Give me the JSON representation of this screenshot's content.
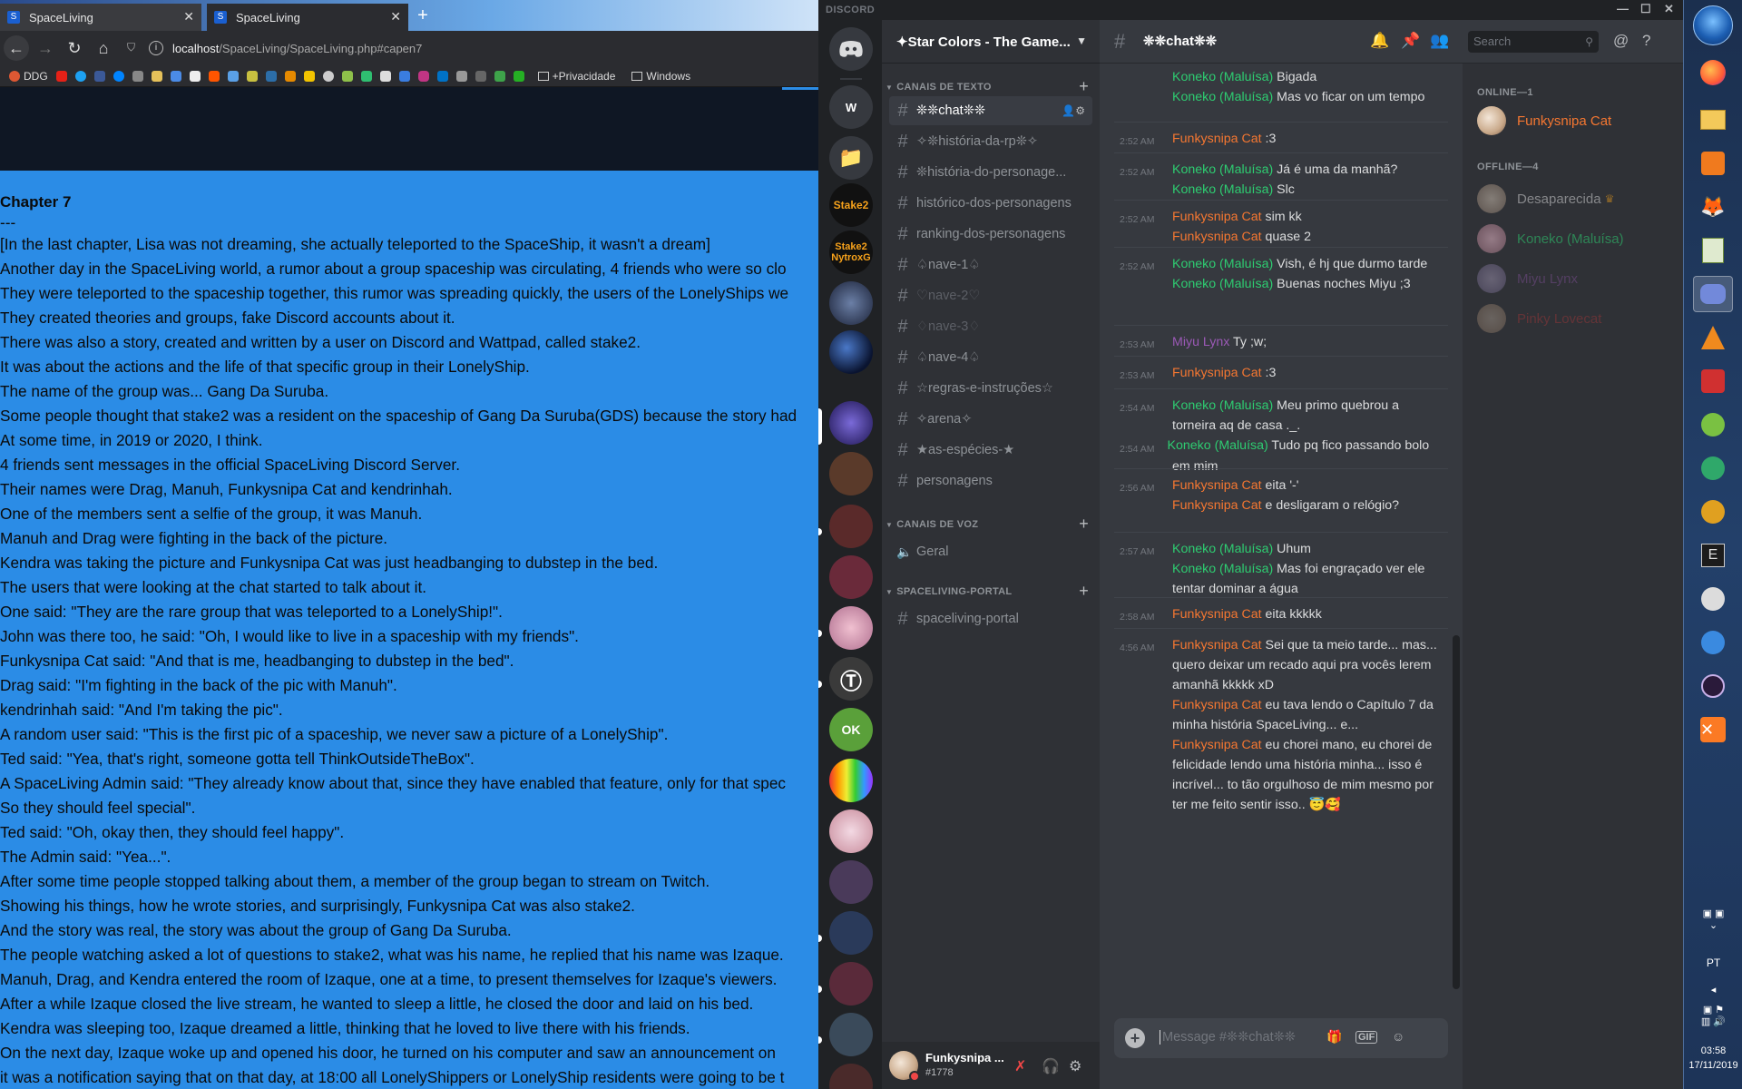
{
  "browser": {
    "tabs": [
      {
        "title": "SpaceLiving",
        "close": "✕"
      },
      {
        "title": "SpaceLiving",
        "close": "✕"
      }
    ],
    "url_host": "localhost",
    "url_path": "/SpaceLiving/SpaceLiving.php#capen7",
    "bookmarks": {
      "ddg": "DDG",
      "folder_privacy": "+Privacidade",
      "folder_windows": "Windows"
    },
    "story": {
      "title": "Chapter 7",
      "separator": "---",
      "lines": [
        "[In the last chapter, Lisa was not dreaming, she actually teleported to the SpaceShip, it wasn't a dream]",
        "Another day in the SpaceLiving world, a rumor about a group spaceship was circulating, 4 friends who were so clo",
        "They were teleported to the spaceship together, this rumor was spreading quickly, the users of the LonelyShips we",
        "They created theories and groups, fake Discord accounts about it.",
        "There was also a story, created and written by a user on Discord and Wattpad, called stake2.",
        "It was about the actions and the life of that specific group in their LonelyShip.",
        "The name of the group was... Gang Da Suruba.",
        "Some people thought that stake2 was a resident on the spaceship of Gang Da Suruba(GDS) because the story had",
        "At some time, in 2019 or 2020, I think.",
        "4 friends sent messages in the official SpaceLiving Discord Server.",
        "Their names were Drag, Manuh, Funkysnipa Cat and kendrinhah.",
        "One of the members sent a selfie of the group, it was Manuh.",
        "Manuh and Drag were fighting in the back of the picture.",
        "Kendra was taking the picture and Funkysnipa Cat was just headbanging to dubstep in the bed.",
        "The users that were looking at the chat started to talk about it.",
        "One said: \"They are the rare group that was teleported to a LonelyShip!\".",
        "John was there too, he said: \"Oh, I would like to live in a spaceship with my friends\".",
        "Funkysnipa Cat said: \"And that is me, headbanging to dubstep in the bed\".",
        "Drag said: \"I'm fighting in the back of the pic with Manuh\".",
        "kendrinhah said: \"And I'm taking the pic\".",
        "A random user said: \"This is the first pic of a spaceship, we never saw a picture of a LonelyShip\".",
        "Ted said: \"Yea, that's right, someone gotta tell ThinkOutsideTheBox\".",
        "A SpaceLiving Admin said: \"They already know about that, since they have enabled that feature, only for that spec",
        "So they should feel special\".",
        "Ted said: \"Oh, okay then, they should feel happy\".",
        "The Admin said: \"Yea...\".",
        "After some time people stopped talking about them, a member of the group began to stream on Twitch.",
        "Showing his things, how he wrote stories, and surprisingly, Funkysnipa Cat was also stake2.",
        "And the story was real, the story was about the group of Gang Da Suruba.",
        "The people watching asked a lot of questions to stake2, what was his name, he replied that his name was Izaque.",
        "Manuh, Drag, and Kendra entered the room of Izaque, one at a time, to present themselves for Izaque's viewers.",
        "After a while Izaque closed the live stream, he wanted to sleep a little, he closed the door and laid on his bed.",
        "Kendra was sleeping too, Izaque dreamed a little, thinking that he loved to live there with his friends.",
        "On the next day, Izaque woke up and opened his door, he turned on his computer and saw an announcement on",
        "it was a notification saying that on that day, at 18:00 all LonelyShippers or LonelyShip residents were going to be t"
      ]
    }
  },
  "discord": {
    "app_name": "DISCORD",
    "window_controls": [
      "—",
      "☐",
      "✕"
    ],
    "server_name": "✦Star Colors - The Game...",
    "guilds": [
      {
        "label": "W",
        "color": "#36393f"
      },
      {
        "label": "📁",
        "color": "#36393f"
      },
      {
        "label": "Stake2",
        "color": "#111111"
      },
      {
        "label": "Stake2 NytroxG",
        "color": "#111111"
      }
    ],
    "categories": {
      "text": "CANAIS DE TEXTO",
      "voice": "CANAIS DE VOZ",
      "portal": "SPACELIVING-PORTAL"
    },
    "text_channels": [
      {
        "name": "❊❊chat❊❊",
        "state": "active"
      },
      {
        "name": "✧❊história-da-rp❊✧",
        "state": "normal"
      },
      {
        "name": "❊história-do-personage...",
        "state": "normal"
      },
      {
        "name": "histórico-dos-personagens",
        "state": "normal"
      },
      {
        "name": "ranking-dos-personagens",
        "state": "normal"
      },
      {
        "name": "♤nave-1♤",
        "state": "normal"
      },
      {
        "name": "♡nave-2♡",
        "state": "muted"
      },
      {
        "name": "♢nave-3♢",
        "state": "muted"
      },
      {
        "name": "♤nave-4♤",
        "state": "normal"
      },
      {
        "name": "☆regras-e-instruções☆",
        "state": "normal"
      },
      {
        "name": "✧arena✧",
        "state": "normal"
      },
      {
        "name": "★as-espécies-★",
        "state": "normal"
      },
      {
        "name": "personagens",
        "state": "normal"
      }
    ],
    "voice_channels": [
      {
        "name": "Geral"
      }
    ],
    "portal_channels": [
      {
        "name": "spaceliving-portal"
      }
    ],
    "current_channel": "❊❊chat❊❊",
    "search_placeholder": "Search",
    "composer_placeholder": "Message #❊❊chat❊❊",
    "composer_gif": "GIF",
    "user": {
      "name": "Funkysnipa ...",
      "tag": "#1778"
    },
    "members": {
      "online_label": "ONLINE—1",
      "offline_label": "OFFLINE—4",
      "online": [
        {
          "name": "Funkysnipa Cat",
          "color": "#f57731"
        }
      ],
      "offline": [
        {
          "name": "Desaparecida",
          "color": "#8e9297"
        },
        {
          "name": "Koneko (Maluísa)",
          "color": "#2ecc71"
        },
        {
          "name": "Miyu Lynx",
          "color": "#9b59b6"
        },
        {
          "name": "Pinky Lovecat",
          "color": "#e03a3a"
        }
      ]
    },
    "messages": [
      {
        "time": "",
        "lines": [
          {
            "author": "Koneko (Maluísa)",
            "cls": "a-koneko",
            "text": "Bigada"
          },
          {
            "author": "Koneko (Maluísa)",
            "cls": "a-koneko",
            "text": "Mas vo ficar on um tempo"
          }
        ]
      },
      {
        "time": "2:52 AM",
        "lines": [
          {
            "author": "Funkysnipa Cat",
            "cls": "a-funky",
            "text": ":3"
          }
        ]
      },
      {
        "time": "2:52 AM",
        "lines": [
          {
            "author": "Koneko (Maluísa)",
            "cls": "a-koneko",
            "text": "Já é uma da manhã?"
          },
          {
            "author": "Koneko (Maluísa)",
            "cls": "a-koneko",
            "text": "Slc"
          }
        ]
      },
      {
        "time": "2:52 AM",
        "lines": [
          {
            "author": "Funkysnipa Cat",
            "cls": "a-funky",
            "text": "sim kk"
          },
          {
            "author": "Funkysnipa Cat",
            "cls": "a-funky",
            "text": "quase 2"
          }
        ]
      },
      {
        "time": "2:52 AM",
        "lines": [
          {
            "author": "Koneko (Maluísa)",
            "cls": "a-koneko",
            "text": "Vish, é hj que durmo tarde"
          },
          {
            "author": "Koneko (Maluísa)",
            "cls": "a-koneko",
            "text": "Buenas noches Miyu ;3"
          }
        ]
      },
      {
        "time": "2:53 AM",
        "lines": [
          {
            "author": "Miyu Lynx",
            "cls": "a-miyu",
            "text": "Ty ;w;"
          }
        ]
      },
      {
        "time": "2:53 AM",
        "lines": [
          {
            "author": "Funkysnipa Cat",
            "cls": "a-funky",
            "text": ":3"
          }
        ]
      },
      {
        "time": "2:54 AM",
        "lines": [
          {
            "author": "Koneko (Maluísa)",
            "cls": "a-koneko",
            "text": "Meu primo quebrou a torneira aq de casa ._."
          },
          {
            "author": "Koneko (Maluísa)",
            "cls": "a-koneko",
            "text": "Tudo pq fico passando bolo em mim",
            "time": "2:54 AM"
          }
        ]
      },
      {
        "time": "2:56 AM",
        "lines": [
          {
            "author": "Funkysnipa Cat",
            "cls": "a-funky",
            "text": "eita '-'"
          },
          {
            "author": "Funkysnipa Cat",
            "cls": "a-funky",
            "text": "e desligaram o relógio?"
          }
        ]
      },
      {
        "time": "2:57 AM",
        "lines": [
          {
            "author": "Koneko (Maluísa)",
            "cls": "a-koneko",
            "text": "Uhum"
          },
          {
            "author": "Koneko (Maluísa)",
            "cls": "a-koneko",
            "text": "Mas foi engraçado ver ele tentar dominar a água"
          }
        ]
      },
      {
        "time": "2:58 AM",
        "lines": [
          {
            "author": "Funkysnipa Cat",
            "cls": "a-funky",
            "text": "eita kkkkk"
          }
        ]
      },
      {
        "time": "4:56 AM",
        "lines": [
          {
            "author": "Funkysnipa Cat",
            "cls": "a-funky",
            "text": "Sei que ta meio tarde... mas... quero deixar um recado aqui pra vocês lerem amanhã kkkkk xD"
          },
          {
            "author": "Funkysnipa Cat",
            "cls": "a-funky",
            "text": "eu tava lendo o Capítulo 7 da minha história SpaceLiving... e..."
          },
          {
            "author": "Funkysnipa Cat",
            "cls": "a-funky",
            "text": "eu chorei mano, eu chorei de felicidade lendo uma história minha... isso é incrível... to tão orgulhoso de mim mesmo por ter me feito sentir isso.. 😇🥰"
          }
        ]
      }
    ]
  },
  "taskbar": {
    "lang": "PT",
    "time": "03:58",
    "date": "17/11/2019"
  }
}
